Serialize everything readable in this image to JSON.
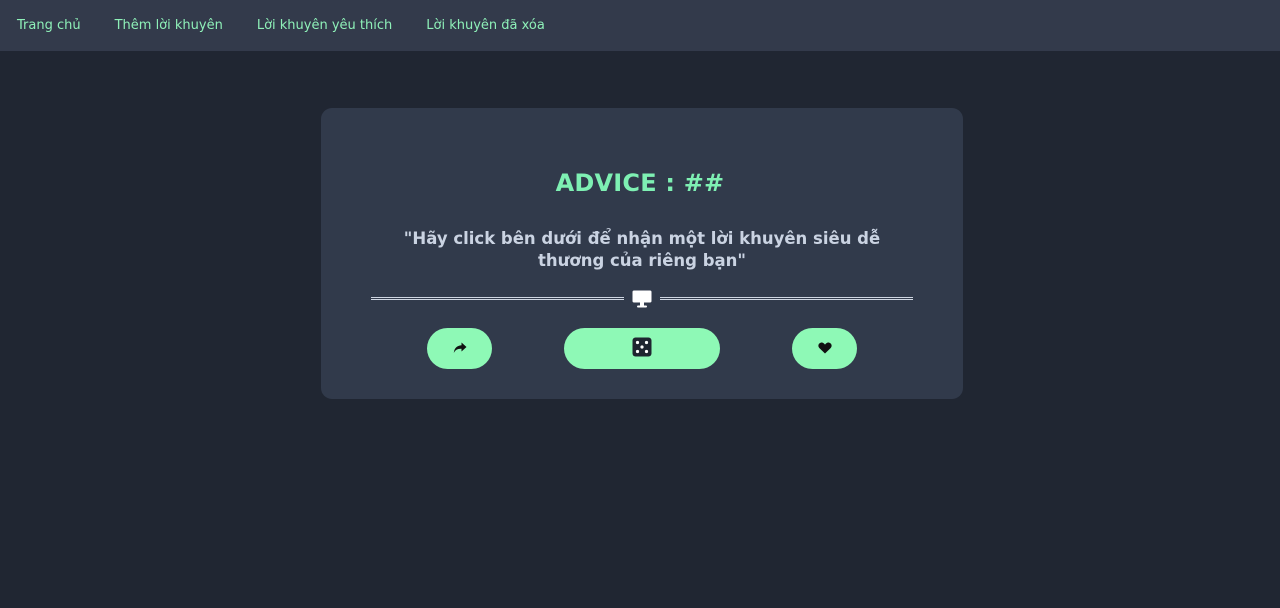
{
  "nav": {
    "items": [
      {
        "label": "Trang chủ"
      },
      {
        "label": "Thêm lời khuyên"
      },
      {
        "label": "Lời khuyên yêu thích"
      },
      {
        "label": "Lời khuyên đã xóa"
      }
    ]
  },
  "card": {
    "title": "ADVICE : ##",
    "quote": "\"Hãy click bên dưới để nhận một lời khuyên siêu dễ thương của riêng bạn\""
  },
  "icons": {
    "divider": "monitor-icon",
    "share": "share-arrow-icon",
    "dice": "dice-icon",
    "like": "heart-icon"
  },
  "colors": {
    "background": "#202632",
    "navbar": "#333a4b",
    "card": "#313a4b",
    "accent": "#8ef9b6",
    "title": "#7ef0b3",
    "text": "#cad3e2"
  }
}
